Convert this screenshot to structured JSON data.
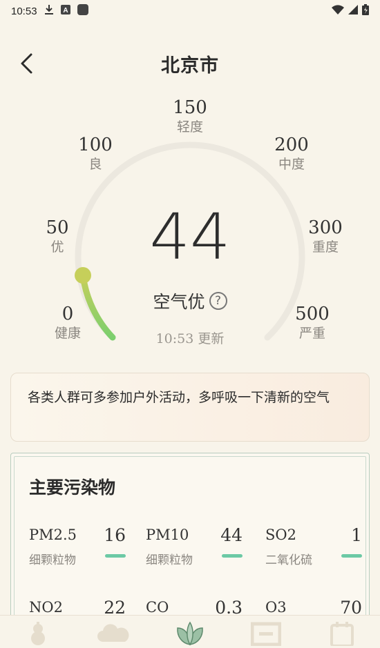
{
  "status_bar": {
    "time": "10:53"
  },
  "header": {
    "title": "北京市"
  },
  "gauge": {
    "ticks": [
      {
        "value": "0",
        "label": "健康"
      },
      {
        "value": "50",
        "label": "优"
      },
      {
        "value": "100",
        "label": "良"
      },
      {
        "value": "150",
        "label": "轻度"
      },
      {
        "value": "200",
        "label": "中度"
      },
      {
        "value": "300",
        "label": "重度"
      },
      {
        "value": "500",
        "label": "严重"
      }
    ],
    "aqi": "44",
    "status": "空气优",
    "update_time": "10:53 更新",
    "track_color": "#ece8df",
    "progress_color_start": "#7ccf6e",
    "progress_color_end": "#c6cf5a"
  },
  "advice": {
    "text": "各类人群可多参加户外活动，多呼吸一下清新的空气"
  },
  "pollutants": {
    "title": "主要污染物",
    "bar_color": "#6cc9a5",
    "items": [
      {
        "name": "PM2.5",
        "value": "16",
        "desc": "细颗粒物"
      },
      {
        "name": "PM10",
        "value": "44",
        "desc": "细颗粒物"
      },
      {
        "name": "SO2",
        "value": "1",
        "desc": "二氧化硫"
      },
      {
        "name": "NO2",
        "value": "22",
        "desc": ""
      },
      {
        "name": "CO",
        "value": "0.3",
        "desc": ""
      },
      {
        "name": "O3",
        "value": "70",
        "desc": ""
      }
    ]
  },
  "tab_bar": {
    "tabs": [
      {
        "icon": "calabash-icon"
      },
      {
        "icon": "cloud-icon"
      },
      {
        "icon": "leaf-icon",
        "active": true
      },
      {
        "icon": "frame-icon"
      },
      {
        "icon": "calendar-icon"
      }
    ]
  }
}
